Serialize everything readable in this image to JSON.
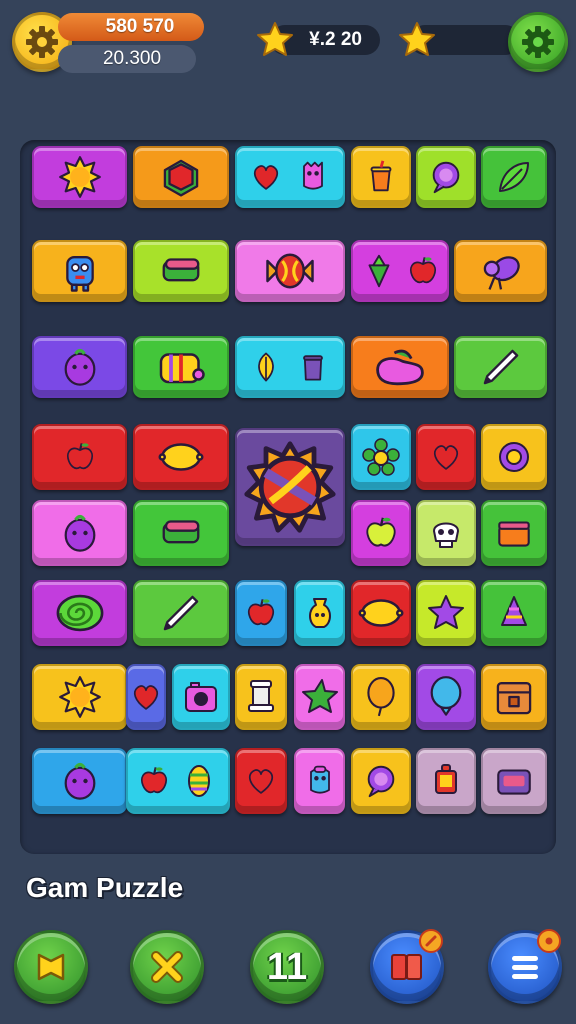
{
  "hud": {
    "coins": "580 570",
    "subtotal": "20.300",
    "multiplier": "¥.2 20",
    "bonus_value": ""
  },
  "footer": {
    "title": "Gam Puzzle",
    "level": "11"
  },
  "icons": {
    "settings_left": "gear-icon",
    "settings_right": "gear-icon",
    "star": "star-icon",
    "hint": "flag-icon",
    "shuffle": "close-icon",
    "book": "book-icon",
    "menu": "menu-icon"
  },
  "colors": {
    "background": "#35435a",
    "board": "#27324a",
    "accent_orange": "#f08a36",
    "accent_green": "#2f9b22",
    "accent_blue": "#1c4fbd"
  },
  "board": {
    "tiles": [
      {
        "color": "#c23ddd",
        "icons": [
          "sun"
        ]
      },
      {
        "color": "#f59a1a",
        "icons": [
          "cube"
        ]
      },
      {
        "color": "#2fd0ea",
        "icons": [
          "heart",
          "monster"
        ]
      },
      {
        "color": "#f7c21c",
        "icons": [
          "cup"
        ]
      },
      {
        "color": "#9fe02a",
        "icons": [
          "bubble"
        ]
      },
      {
        "color": "#45c23a",
        "icons": [
          "leaf"
        ]
      },
      {
        "color": "#f7b21c",
        "icons": [
          "robot"
        ]
      },
      {
        "color": "#a8e12a",
        "icons": [
          "book"
        ]
      },
      {
        "color": "#f07ae8",
        "icons": [
          "candy"
        ]
      },
      {
        "color": "#d43fdf",
        "icons": [
          "cone",
          "apple"
        ]
      },
      {
        "color": "#f7a51c",
        "icons": [
          "grapes"
        ]
      },
      {
        "color": "#7b49e6",
        "icons": [
          "berry"
        ]
      },
      {
        "color": "#43c63a",
        "icons": [
          "barrel"
        ]
      },
      {
        "color": "#2fd0ea",
        "icons": [
          "leaf-yellow",
          "pot"
        ]
      },
      {
        "color": "#f77d1c",
        "icons": [
          "shoe"
        ]
      },
      {
        "color": "#5cc93e",
        "icons": [
          "pen"
        ]
      },
      {
        "color": "#e1272a",
        "icons": [
          "apple"
        ]
      },
      {
        "color": "#e1272a",
        "icons": [
          "lemon"
        ]
      },
      {
        "color": "#6a4a9e",
        "icons": [
          "ball"
        ]
      },
      {
        "color": "#2fc6ea",
        "icons": [
          "flower"
        ]
      },
      {
        "color": "#e1272a",
        "icons": [
          "heart"
        ]
      },
      {
        "color": "#f7c21c",
        "icons": [
          "ring"
        ]
      },
      {
        "color": "#f06de8",
        "icons": [
          "berry"
        ]
      },
      {
        "color": "#43c63a",
        "icons": [
          "book"
        ]
      },
      {
        "color": "#d43fdf",
        "icons": [
          "apple-green"
        ]
      },
      {
        "color": "#c6e96a",
        "icons": [
          "skull"
        ]
      },
      {
        "color": "#45c23a",
        "icons": [
          "box"
        ]
      },
      {
        "color": "#c23ddd",
        "icons": [
          "swirl"
        ]
      },
      {
        "color": "#5cc93e",
        "icons": [
          "pen"
        ]
      },
      {
        "color": "#2fa6ea",
        "icons": [
          "apple"
        ]
      },
      {
        "color": "#2fd0ea",
        "icons": [
          "vase"
        ]
      },
      {
        "color": "#e1272a",
        "icons": [
          "lemon"
        ]
      },
      {
        "color": "#c6e92a",
        "icons": [
          "star-purple"
        ]
      },
      {
        "color": "#45c23a",
        "icons": [
          "cone-purple"
        ]
      },
      {
        "color": "#f7c21c",
        "icons": [
          "sun"
        ]
      },
      {
        "color": "#5a6ae6",
        "icons": [
          "heart"
        ]
      },
      {
        "color": "#2fd0ea",
        "icons": [
          "camera"
        ]
      },
      {
        "color": "#f7c21c",
        "icons": [
          "lamp"
        ]
      },
      {
        "color": "#f06de8",
        "icons": [
          "star-green"
        ]
      },
      {
        "color": "#f7c21c",
        "icons": [
          "balloon"
        ]
      },
      {
        "color": "#a24ae6",
        "icons": [
          "balloon-blue"
        ]
      },
      {
        "color": "#f7b21c",
        "icons": [
          "chest"
        ]
      },
      {
        "color": "#2fa6ea",
        "icons": [
          "berry"
        ]
      },
      {
        "color": "#2fd0ea",
        "icons": [
          "apple",
          "cone-yellow"
        ]
      },
      {
        "color": "#e1272a",
        "icons": [
          "heart"
        ]
      },
      {
        "color": "#f06de8",
        "icons": [
          "monster-blue"
        ]
      },
      {
        "color": "#f7c21c",
        "icons": [
          "bubble"
        ]
      },
      {
        "color": "#c9a6c9",
        "icons": [
          "lamp-red"
        ]
      },
      {
        "color": "#c9a6c9",
        "icons": [
          "radio"
        ]
      }
    ]
  }
}
